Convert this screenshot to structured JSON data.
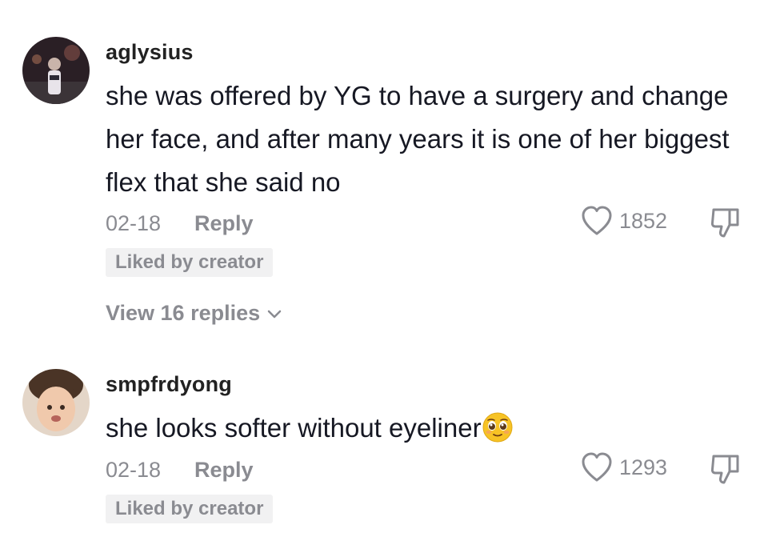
{
  "comments": [
    {
      "username": "aglysius",
      "text": "she was offered by YG to have a surgery and change her face, and after many years it is one of her biggest flex that she said no",
      "date": "02-18",
      "reply_label": "Reply",
      "likes": "1852",
      "badge": "Liked by creator",
      "view_replies": "View 16 replies",
      "avatar_icon": "night-street-photo-avatar"
    },
    {
      "username": "smpfrdyong",
      "text": "she looks softer without eyeliner",
      "emoji_icon": "pleading-face-emoji",
      "date": "02-18",
      "reply_label": "Reply",
      "likes": "1293",
      "badge": "Liked by creator",
      "avatar_icon": "child-photo-avatar"
    }
  ],
  "icons": {
    "like": "heart-outline-icon",
    "dislike": "thumbs-down-icon",
    "expand": "chevron-down-icon"
  },
  "colors": {
    "primary_text": "#161823",
    "secondary_text": "#8a8b91",
    "badge_bg": "#f1f1f2"
  }
}
